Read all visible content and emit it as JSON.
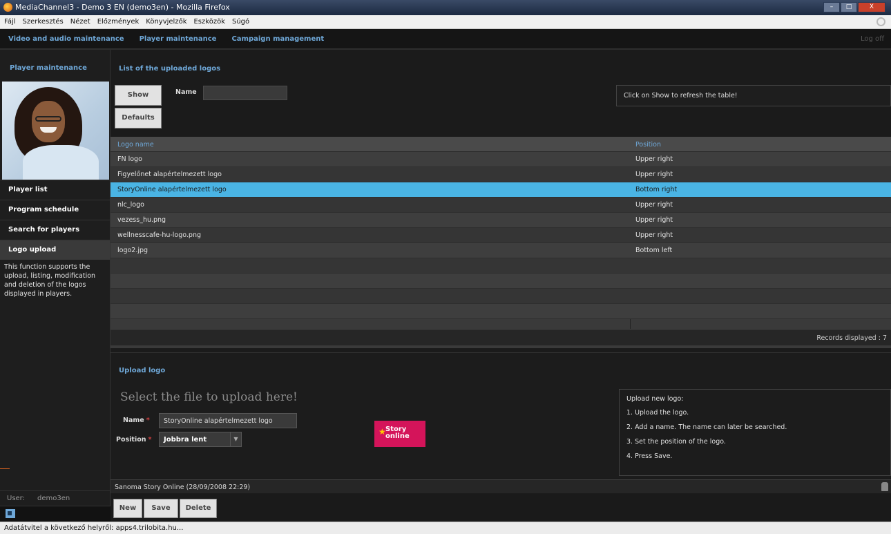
{
  "window": {
    "title": "MediaChannel3 - Demo 3 EN (demo3en) - Mozilla Firefox",
    "controls": {
      "minimize": "–",
      "maximize": "□",
      "close": "X"
    }
  },
  "menubar": [
    "Fájl",
    "Szerkesztés",
    "Nézet",
    "Előzmények",
    "Könyvjelzők",
    "Eszközök",
    "Súgó"
  ],
  "topnav": {
    "items": [
      "Video and audio maintenance",
      "Player maintenance",
      "Campaign management"
    ],
    "logoff": "Log off"
  },
  "sidebar": {
    "title": "Player maintenance",
    "items": [
      "Player list",
      "Program schedule",
      "Search for players",
      "Logo upload"
    ],
    "active_index": 3,
    "description": "This function supports the upload, listing, modification and deletion of the logos displayed in players.",
    "user_label": "User:",
    "user_name": "demo3en"
  },
  "logo_list": {
    "title": "List of the uploaded logos",
    "show_button": "Show",
    "defaults_button": "Defaults",
    "name_label": "Name",
    "name_value": "",
    "hint": "Click on Show to refresh the table!",
    "columns": [
      "Logo name",
      "Position"
    ],
    "rows": [
      {
        "name": "FN logo",
        "position": "Upper right"
      },
      {
        "name": "Figyelőnet alapértelmezett logo",
        "position": "Upper right"
      },
      {
        "name": "StoryOnline alapértelmezett logo",
        "position": "Bottom right"
      },
      {
        "name": "nlc_logo",
        "position": "Upper right"
      },
      {
        "name": "vezess_hu.png",
        "position": "Upper right"
      },
      {
        "name": "wellnesscafe-hu-logo.png",
        "position": "Upper right"
      },
      {
        "name": "logo2.jpg",
        "position": "Bottom left"
      }
    ],
    "selected_index": 2,
    "records_text": "Records displayed : 7"
  },
  "upload": {
    "title": "Upload logo",
    "prompt": "Select the file to upload here!",
    "name_label": "Name",
    "name_value": "StoryOnline alapértelmezett logo",
    "position_label": "Position",
    "position_value": "Jobbra lent",
    "required_mark": "*",
    "preview_text": "Story online",
    "instructions": [
      "Upload new logo:",
      "1. Upload the logo.",
      "2. Add a name. The name can later be searched.",
      "3. Set the position of the logo.",
      "4. Press Save."
    ]
  },
  "record_info": "Sanoma Story Online (28/09/2008 22:29)",
  "actions": {
    "new": "New",
    "save": "Save",
    "delete": "Delete"
  },
  "statusbar": "Adatátvitel a következő helyről: apps4.trilobita.hu...",
  "colors": {
    "accent": "#6fa8d8",
    "selected_row": "#4ab4e4",
    "logo_preview": "#d4145a"
  }
}
